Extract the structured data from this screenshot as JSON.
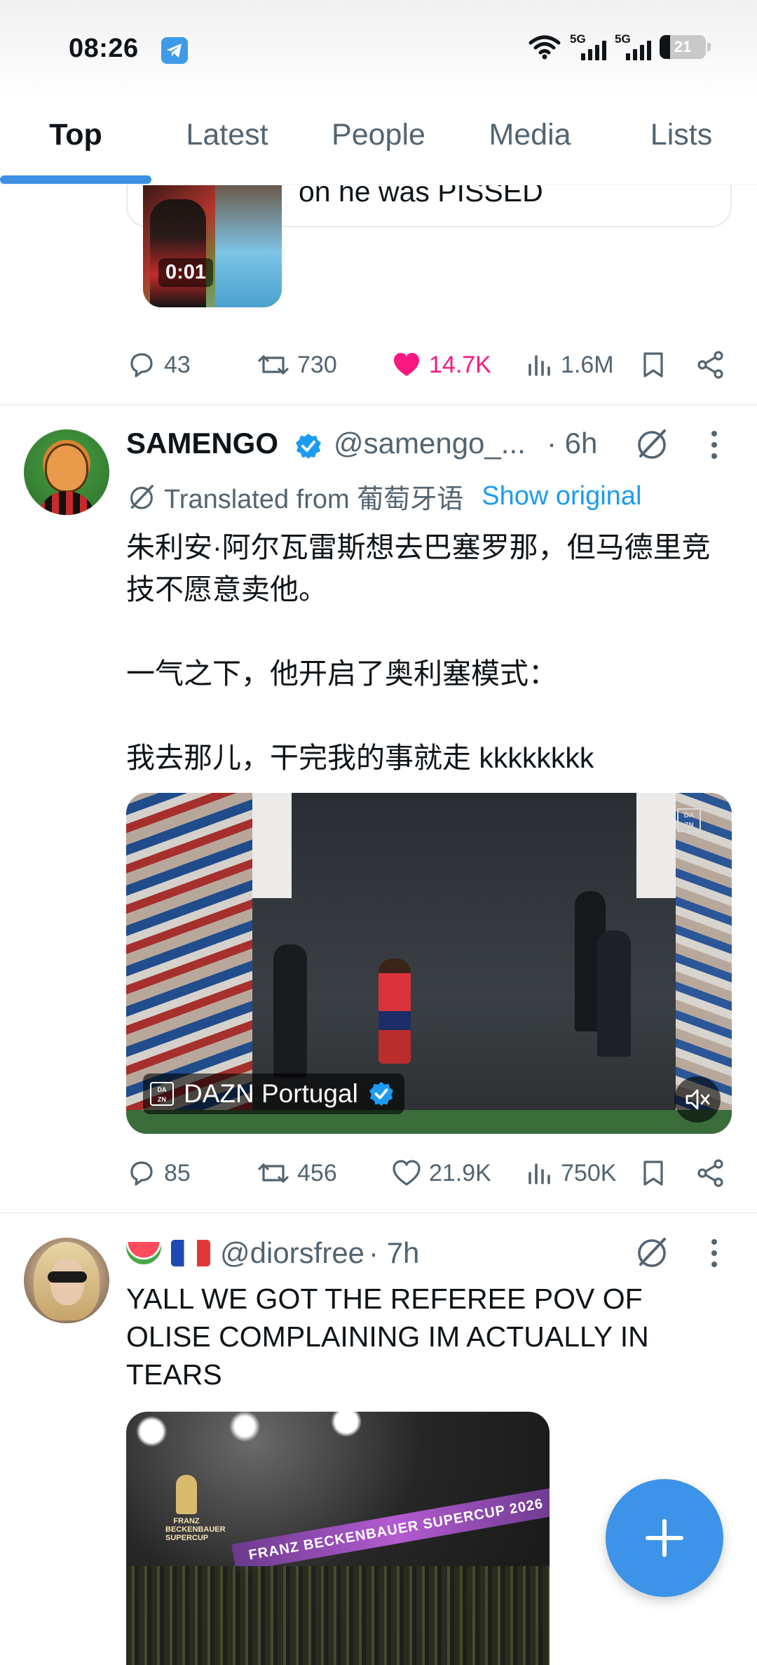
{
  "status_bar": {
    "time": "08:26",
    "net1": "5G",
    "net2": "5G",
    "battery": "21"
  },
  "tabs": [
    "Top",
    "Latest",
    "People",
    "Media",
    "Lists"
  ],
  "active_tab": "Top",
  "prev_tweet": {
    "text_tail": "on he was PISSED",
    "video_duration": "0:01",
    "stats": {
      "replies": "43",
      "reposts": "730",
      "likes": "14.7K",
      "views": "1.6M"
    }
  },
  "tweet1": {
    "name": "SAMENGO",
    "handle": "@samengo_...",
    "time": "· 6h",
    "translated_label": "Translated from 葡萄牙语",
    "show_original": "Show original",
    "paragraphs": [
      "朱利安·阿尔瓦雷斯想去巴塞罗那，但马德里竞技不愿意卖他。",
      "一气之下，他开启了奥利塞模式：",
      "我去那儿，干完我的事就走 kkkkkkkk"
    ],
    "media_source": "DAZN Portugal",
    "stats": {
      "replies": "85",
      "reposts": "456",
      "likes": "21.9K",
      "views": "750K"
    }
  },
  "tweet2": {
    "handle": "@diorsfree",
    "time": "· 7h",
    "text": "YALL WE GOT THE REFEREE POV OF OLISE COMPLAINING IM ACTUALLY IN TEARS",
    "media_banner": "FRANZ BECKENBAUER SUPERCUP 2026",
    "media_trophy": "FRANZ BECKENBAUER SUPERCUP"
  },
  "colors": {
    "accent": "#1d9bf0",
    "like": "#f91880",
    "fab": "#3d93e8",
    "tab_indicator": "#3d8fe3"
  }
}
